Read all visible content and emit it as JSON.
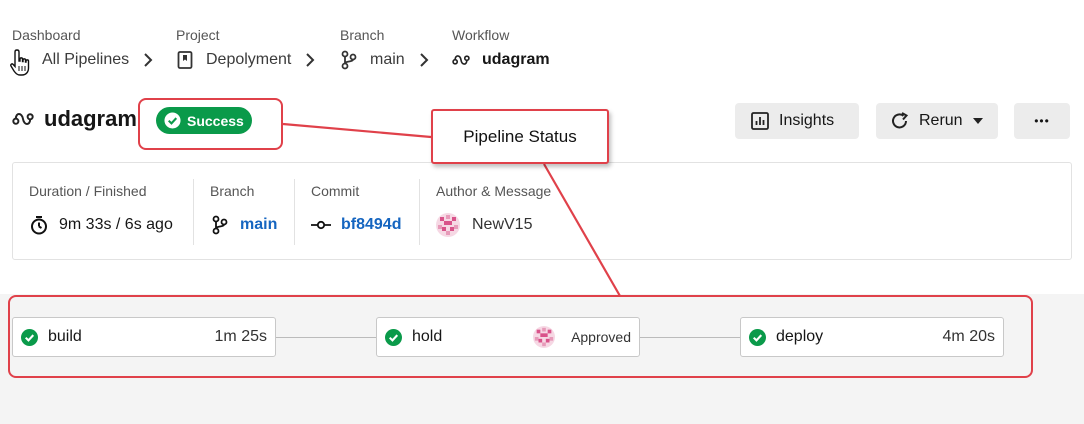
{
  "breadcrumbs": [
    {
      "label": "Dashboard",
      "value": "All Pipelines",
      "icon": "cursor-icon"
    },
    {
      "label": "Project",
      "value": "Depolyment",
      "icon": "bookmark-icon"
    },
    {
      "label": "Branch",
      "value": "main",
      "icon": "branch-icon"
    },
    {
      "label": "Workflow",
      "value": "udagram",
      "icon": "workflow-icon"
    }
  ],
  "header": {
    "workflow_name": "udagram",
    "status": "Success",
    "insights_label": "Insights",
    "rerun_label": "Rerun",
    "more_label": "•••"
  },
  "summary": {
    "duration_label": "Duration / Finished",
    "duration_value": "9m 33s / 6s ago",
    "branch_label": "Branch",
    "branch_value": "main",
    "commit_label": "Commit",
    "commit_value": "bf8494d",
    "author_label": "Author & Message",
    "author_value": "NewV15"
  },
  "jobs": [
    {
      "name": "build",
      "meta": "1m 25s"
    },
    {
      "name": "hold",
      "meta": "Approved"
    },
    {
      "name": "deploy",
      "meta": "4m 20s"
    }
  ],
  "annotation": {
    "label": "Pipeline Status"
  },
  "colors": {
    "success": "#0a9a4a",
    "link": "#1565c0",
    "annotation": "#e0414a"
  }
}
